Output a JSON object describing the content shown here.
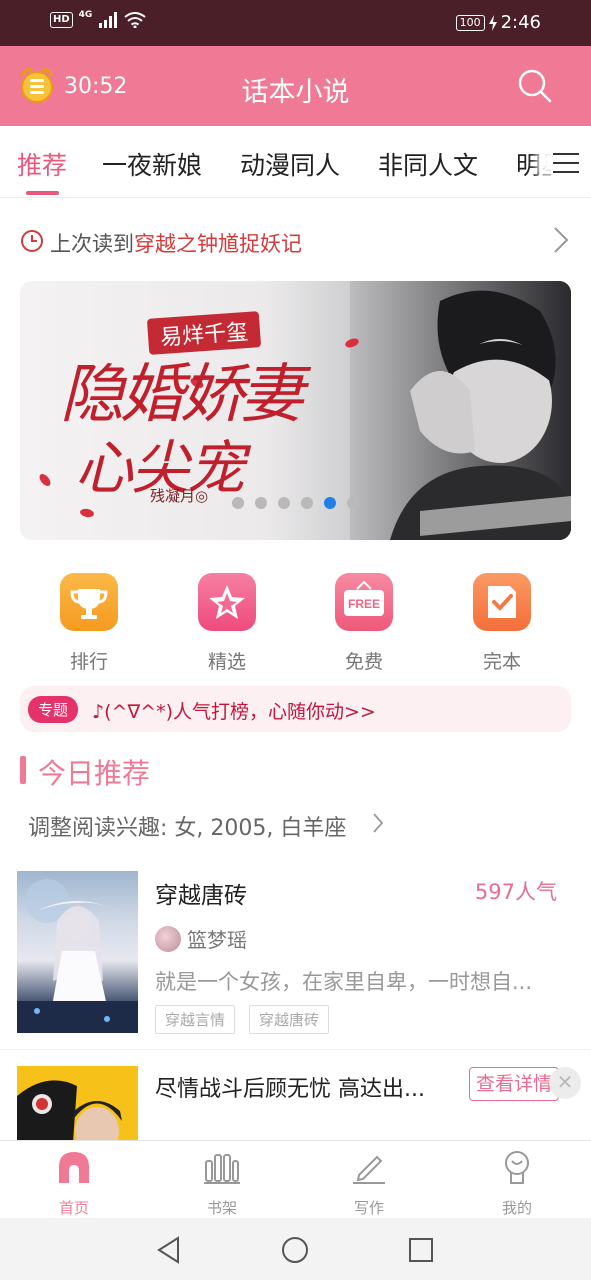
{
  "status_bar": {
    "hd": "HD",
    "network": "4G",
    "battery": "100",
    "time": "2:46"
  },
  "header": {
    "timer": "30:52",
    "title": "话本小说"
  },
  "tabs": [
    "推荐",
    "一夜新娘",
    "动漫同人",
    "非同人文",
    "明星"
  ],
  "last_read": {
    "prefix": "上次读到",
    "book": "穿越之钟馗捉妖记"
  },
  "banner": {
    "tag": "易烊千玺",
    "title_line1": "隐婚娇妻",
    "title_line2": "心尖宠",
    "author": "残凝月◎",
    "dot_count": 6,
    "active_dot": 4
  },
  "categories": [
    {
      "label": "排行",
      "icon": "trophy-icon",
      "color": "#f7a233"
    },
    {
      "label": "精选",
      "icon": "star-icon",
      "color": "#f05d8a"
    },
    {
      "label": "免费",
      "icon": "free-sign-icon",
      "color": "#f06f8c",
      "badge": "FREE"
    },
    {
      "label": "完本",
      "icon": "check-note-icon",
      "color": "#f7824c"
    }
  ],
  "topic": {
    "badge": "专题",
    "text": "♪(^∇^*)人气打榜，心随你动>>"
  },
  "section": {
    "title": "今日推荐",
    "interest": "调整阅读兴趣: 女, 2005, 白羊座"
  },
  "books": [
    {
      "title": "穿越唐砖",
      "popularity": "597人气",
      "author": "篮梦瑶",
      "desc": "就是一个女孩，在家里自卑，一时想自...",
      "tags": [
        "穿越言情",
        "穿越唐砖"
      ]
    },
    {
      "title": "尽情战斗后顾无忧 高达出...",
      "action": "查看详情",
      "close": "✕"
    }
  ],
  "bottom_nav": [
    {
      "label": "首页",
      "icon": "home-icon",
      "active": true
    },
    {
      "label": "书架",
      "icon": "bookshelf-icon",
      "active": false
    },
    {
      "label": "写作",
      "icon": "pen-icon",
      "active": false
    },
    {
      "label": "我的",
      "icon": "profile-icon",
      "active": false
    }
  ],
  "colors": {
    "brand": "#f07a95",
    "status_bar": "#4a1f27",
    "accent_red": "#d43b3b",
    "dot_active": "#1e7fe8"
  }
}
